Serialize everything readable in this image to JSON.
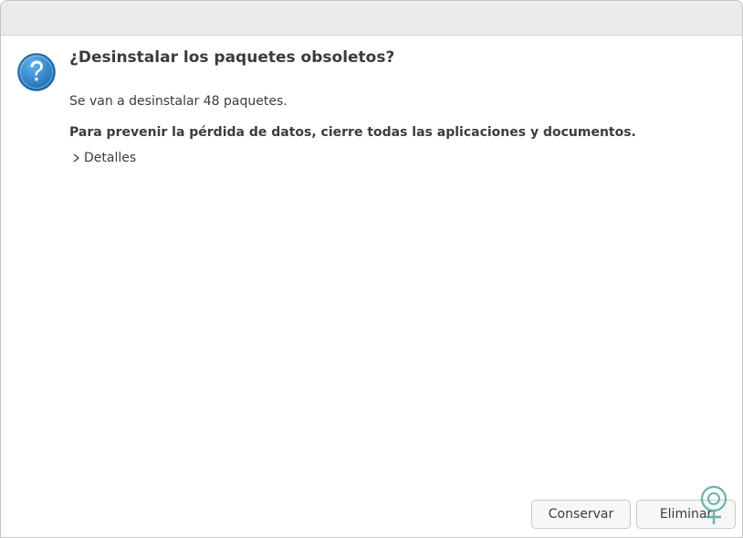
{
  "dialog": {
    "title": "¿Desinstalar los paquetes obsoletos?",
    "message": "Se van a desinstalar 48 paquetes.",
    "warning": "Para prevenir la pérdida de datos, cierre todas las aplicaciones y documentos.",
    "details_label": "Detalles",
    "icon": "question-icon"
  },
  "buttons": {
    "keep_label": "Conservar",
    "remove_label": "Eliminar"
  },
  "colors": {
    "icon_blue": "#2a7fc6",
    "text": "#3c3c3c",
    "titlebar": "#ebebeb"
  }
}
